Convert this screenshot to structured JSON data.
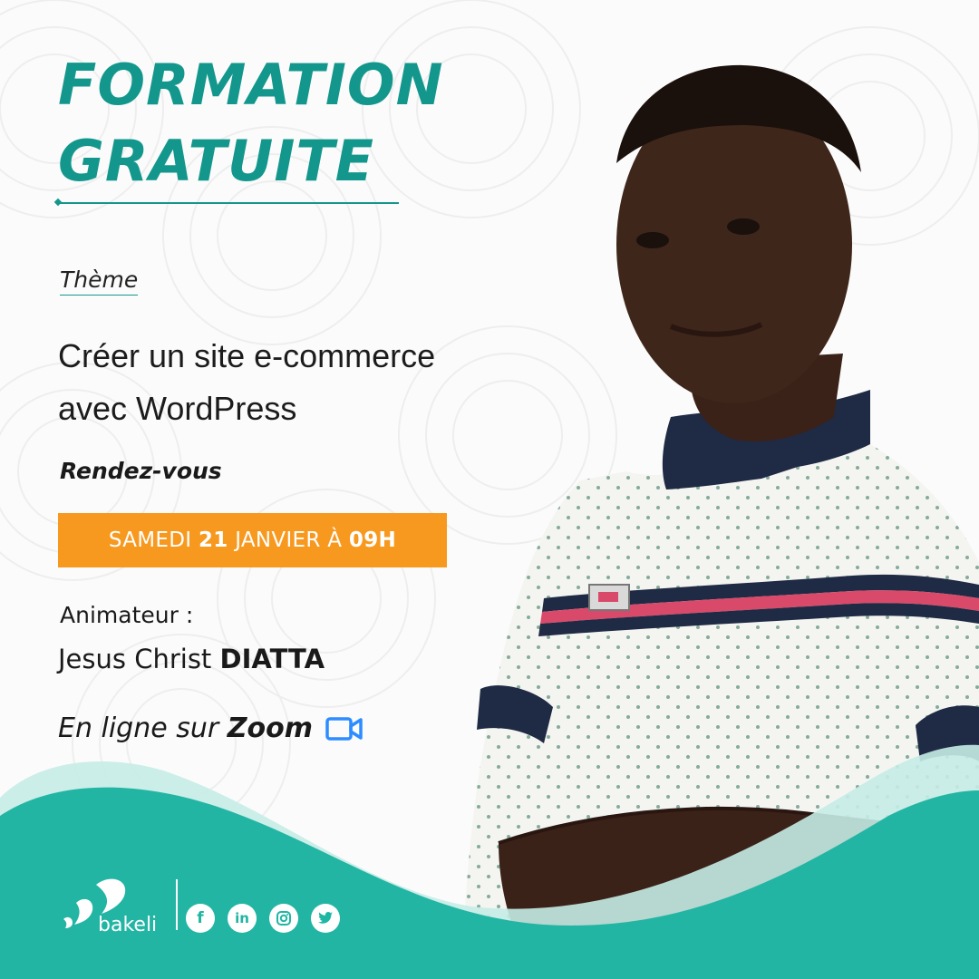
{
  "title": {
    "line1": "FORMATION",
    "line2": "GRATUITE"
  },
  "theme": {
    "label": "Thème",
    "line1": "Créer un site e-commerce",
    "line2": "avec WordPress"
  },
  "rendezvous": {
    "label": "Rendez-vous",
    "day": "SAMEDI ",
    "date_num": "21",
    "month": " JANVIER À ",
    "time": "09H"
  },
  "animateur": {
    "label": "Animateur :",
    "first_names": "Jesus Christ ",
    "last_name": "DIATTA"
  },
  "online": {
    "prefix": "En ligne sur ",
    "platform": "Zoom"
  },
  "brand": {
    "name": "bakeli",
    "socials": [
      "facebook-icon",
      "linkedin-icon",
      "instagram-icon",
      "twitter-icon"
    ]
  },
  "colors": {
    "accent_teal": "#13978c",
    "wave_teal": "#23b5a4",
    "badge_orange": "#f8991f",
    "zoom_blue": "#2d8cff"
  }
}
